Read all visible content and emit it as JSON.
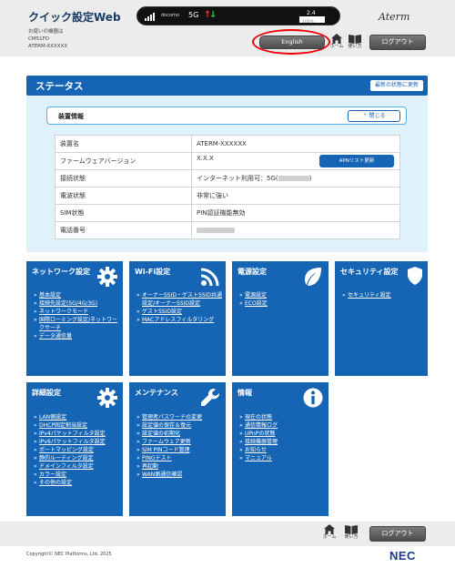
{
  "header": {
    "title": "クイック設定Web",
    "device_line1": "お使いの機器は",
    "device_line2": "CM51FD",
    "device_line3": "ATERM-XXXXXX",
    "carrier": "docomo",
    "network_type": "5G",
    "battery_label": "2.4",
    "battery_percent": "100%",
    "battery_level": 1.0,
    "logo": "Aterm",
    "english_label": "English",
    "home_label": "ホーム",
    "manual_label": "使い方",
    "logout_label": "ログアウト",
    "icons": {
      "home": "home-icon",
      "manual": "book-icon"
    }
  },
  "status": {
    "title": "ステータス",
    "refresh_label": "最新の状態に更新",
    "device_info_title": "装置情報",
    "collapse_label": "閉じる",
    "rows": [
      {
        "key": "装置名",
        "value": "ATERM-XXXXXX"
      },
      {
        "key": "ファームウェアバージョン",
        "value": "X.X.X",
        "button": "APNリスト更新"
      },
      {
        "key": "接続状態",
        "value": "インターネット利用可：5G(",
        "value_suffix": ")"
      },
      {
        "key": "電波状態",
        "value": "非常に強い"
      },
      {
        "key": "SIM状態",
        "value": "PIN認証機能無効"
      },
      {
        "key": "電話番号",
        "value": ""
      }
    ]
  },
  "tiles": {
    "network": {
      "title": "ネットワーク設定",
      "icon": "gear-icon",
      "links": [
        "基本設定",
        "接続先設定(5G/4G/3G)",
        "ネットワークモード",
        "国際ローミング設定/ネットワークサーチ",
        "データ通信量"
      ]
    },
    "wifi": {
      "title": "Wi-Fi設定",
      "icon": "wifi-icon",
      "links": [
        "オーナーSSID・ゲストSSID共通設定/オーナーSSID設定",
        "ゲストSSID設定",
        "MACアドレスフィルタリング"
      ]
    },
    "power": {
      "title": "電源設定",
      "icon": "leaf-icon",
      "links": [
        "電源設定",
        "ECO設定"
      ]
    },
    "security": {
      "title": "セキュリティ設定",
      "icon": "shield-icon",
      "links": [
        "セキュリティ設定"
      ]
    },
    "detail": {
      "title": "詳細設定",
      "icon": "gear-icon",
      "links": [
        "LAN側設定",
        "DHCP固定割当設定",
        "IPv4パケットフィルタ設定",
        "IPv6パケットフィルタ設定",
        "ポートマッピング設定",
        "静的ルーティング設定",
        "ドメインフィルタ設定",
        "カラー設定",
        "その他の設定"
      ]
    },
    "maintenance": {
      "title": "メンテナンス",
      "icon": "wrench-icon",
      "links": [
        "管理者パスワードの変更",
        "設定値の保存＆復元",
        "設定値の初期化",
        "ファームウェア更新",
        "SIM PINコード管理",
        "PINGテスト",
        "再起動",
        "WAN側通信確認"
      ]
    },
    "info": {
      "title": "情報",
      "icon": "info-icon",
      "links": [
        "現在の状態",
        "通信情報ログ",
        "UPnPの状態",
        "接続機器管理",
        "お知らせ",
        "マニュアル"
      ]
    }
  },
  "footer": {
    "home_label": "ホーム",
    "manual_label": "使い方",
    "logout_label": "ログアウト",
    "copyright": "Copyright© NEC Platforms, Ltd. 2025",
    "brand": "NEC"
  },
  "colors": {
    "primary": "#1665b5",
    "highlight": "#e00000",
    "panel": "#dff1fb"
  }
}
